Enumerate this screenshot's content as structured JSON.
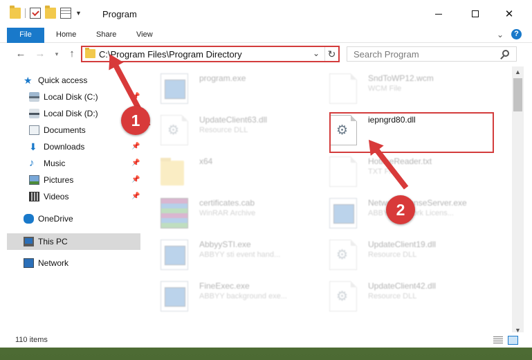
{
  "window": {
    "title": "Program"
  },
  "ribbon": {
    "tabs": [
      "File",
      "Home",
      "Share",
      "View"
    ]
  },
  "address": {
    "path": "C:\\Program Files\\Program Directory"
  },
  "search": {
    "placeholder": "Search Program"
  },
  "sidebar": {
    "quick_access": "Quick access",
    "items": [
      "Local Disk (C:)",
      "Local Disk (D:)",
      "Documents",
      "Downloads",
      "Music",
      "Pictures",
      "Videos"
    ],
    "onedrive": "OneDrive",
    "this_pc": "This PC",
    "network": "Network"
  },
  "files": [
    {
      "name": "program.exe",
      "desc": "",
      "icon": "exe-icon"
    },
    {
      "name": "SndToWP12.wcm",
      "desc": "WCM File",
      "icon": "file-icon"
    },
    {
      "name": "UpdateClient63.dll",
      "desc": "Resource DLL",
      "icon": "gear-file-icon"
    },
    {
      "name": "iepngrd80.dll",
      "desc": "",
      "icon": "gear-file-icon"
    },
    {
      "name": "x64",
      "desc": "",
      "icon": "folder-icon"
    },
    {
      "name": "HotlineReader.txt",
      "desc": "TXT File",
      "icon": "file-icon"
    },
    {
      "name": "certificates.cab",
      "desc": "WinRAR Archive",
      "icon": "archive-icon"
    },
    {
      "name": "NetworkLicenseServer.exe",
      "desc": "ABBYY Network Licens...",
      "icon": "exe-icon"
    },
    {
      "name": "AbbyySTI.exe",
      "desc": "ABBYY sti event hand...",
      "icon": "exe-icon"
    },
    {
      "name": "UpdateClient19.dll",
      "desc": "Resource DLL",
      "icon": "gear-file-icon"
    },
    {
      "name": "FineExec.exe",
      "desc": "ABBYY background exe...",
      "icon": "exe-icon"
    },
    {
      "name": "UpdateClient42.dll",
      "desc": "Resource DLL",
      "icon": "gear-file-icon"
    }
  ],
  "callouts": [
    "1",
    "2"
  ],
  "status": {
    "item_count": "110 items"
  },
  "colors": {
    "accent": "#1979ca",
    "highlight": "#d33c3c"
  }
}
